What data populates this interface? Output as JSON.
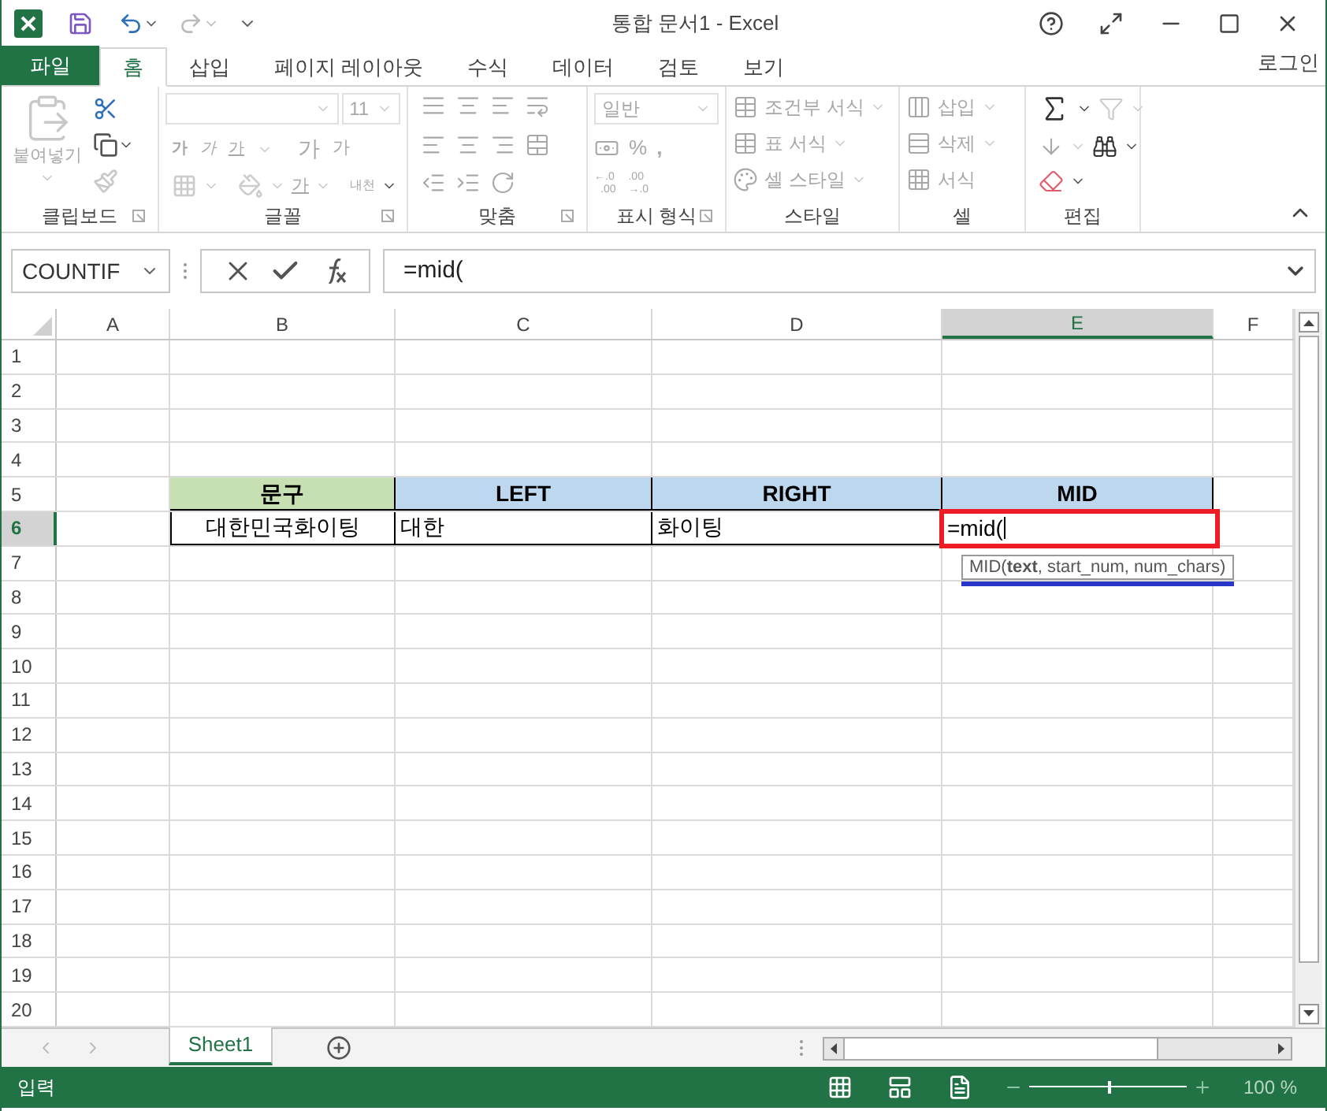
{
  "window": {
    "title": "통합 문서1 - Excel"
  },
  "ribbon_tabs": [
    {
      "label": "파일",
      "kind": "file",
      "selected": false
    },
    {
      "label": "홈",
      "kind": "tab",
      "selected": true
    },
    {
      "label": "삽입",
      "kind": "tab",
      "selected": false
    },
    {
      "label": "페이지 레이아웃",
      "kind": "tab",
      "selected": false
    },
    {
      "label": "수식",
      "kind": "tab",
      "selected": false
    },
    {
      "label": "데이터",
      "kind": "tab",
      "selected": false
    },
    {
      "label": "검토",
      "kind": "tab",
      "selected": false
    },
    {
      "label": "보기",
      "kind": "tab",
      "selected": false
    }
  ],
  "sign_in": "로그인",
  "ribbon": {
    "disabled": true,
    "clipboard": {
      "label": "클립보드",
      "paste": "붙여넣기"
    },
    "font": {
      "label": "글꼴",
      "size": "11",
      "bold": "가",
      "italic": "가",
      "underline": "가",
      "grow": "가",
      "shrink": "가",
      "font_color": "가",
      "phonetic": "내천"
    },
    "alignment": {
      "label": "맞춤"
    },
    "number": {
      "label": "표시 형식",
      "format": "일반",
      "percent": "%",
      "comma": ",",
      "increase_decimal": [
        "←.0",
        ".00"
      ],
      "decrease_decimal": [
        ".00",
        "→.0"
      ]
    },
    "styles": {
      "label": "스타일",
      "items": [
        "조건부 서식",
        "표 서식",
        "셀 스타일"
      ]
    },
    "cells": {
      "label": "셀",
      "items": [
        "삽입",
        "삭제",
        "서식"
      ]
    },
    "editing": {
      "label": "편집"
    }
  },
  "formula_bar": {
    "name_box": "COUNTIF",
    "formula": "=mid("
  },
  "sheet": {
    "columns": [
      {
        "label": "A",
        "selected": false
      },
      {
        "label": "B",
        "selected": false
      },
      {
        "label": "C",
        "selected": false
      },
      {
        "label": "D",
        "selected": false
      },
      {
        "label": "E",
        "selected": true
      },
      {
        "label": "F",
        "selected": false
      }
    ],
    "rows": [
      {
        "label": "1",
        "selected": false
      },
      {
        "label": "2",
        "selected": false
      },
      {
        "label": "3",
        "selected": false
      },
      {
        "label": "4",
        "selected": false
      },
      {
        "label": "5",
        "selected": false,
        "cells": [
          null,
          {
            "text": "문구",
            "kind": "header",
            "color": "#c6e0b4"
          },
          {
            "text": "LEFT",
            "kind": "header",
            "color": "#bdd7ee"
          },
          {
            "text": "RIGHT",
            "kind": "header",
            "color": "#bdd7ee"
          },
          {
            "text": "MID",
            "kind": "header",
            "color": "#bdd7ee"
          }
        ]
      },
      {
        "label": "6",
        "selected": true,
        "cells": [
          null,
          {
            "text": "대한민국화이팅",
            "kind": "label"
          },
          {
            "text": "대한",
            "kind": "value"
          },
          {
            "text": "화이팅",
            "kind": "value"
          },
          {
            "text": "=mid(",
            "kind": "editing"
          }
        ]
      },
      {
        "label": "7",
        "selected": false
      },
      {
        "label": "8",
        "selected": false
      },
      {
        "label": "9",
        "selected": false
      },
      {
        "label": "10",
        "selected": false
      },
      {
        "label": "11",
        "selected": false
      },
      {
        "label": "12",
        "selected": false
      },
      {
        "label": "13",
        "selected": false
      },
      {
        "label": "14",
        "selected": false
      },
      {
        "label": "15",
        "selected": false
      },
      {
        "label": "16",
        "selected": false
      },
      {
        "label": "17",
        "selected": false
      },
      {
        "label": "18",
        "selected": false
      },
      {
        "label": "19",
        "selected": false
      },
      {
        "label": "20",
        "selected": false
      }
    ],
    "function_tip": "MID(**text**, start_num, num_chars)"
  },
  "sheet_tabs": [
    {
      "label": "Sheet1",
      "selected": true
    }
  ],
  "status_bar": {
    "mode": "입력",
    "zoom": {
      "level": 0.5,
      "reading": "100 %"
    }
  }
}
